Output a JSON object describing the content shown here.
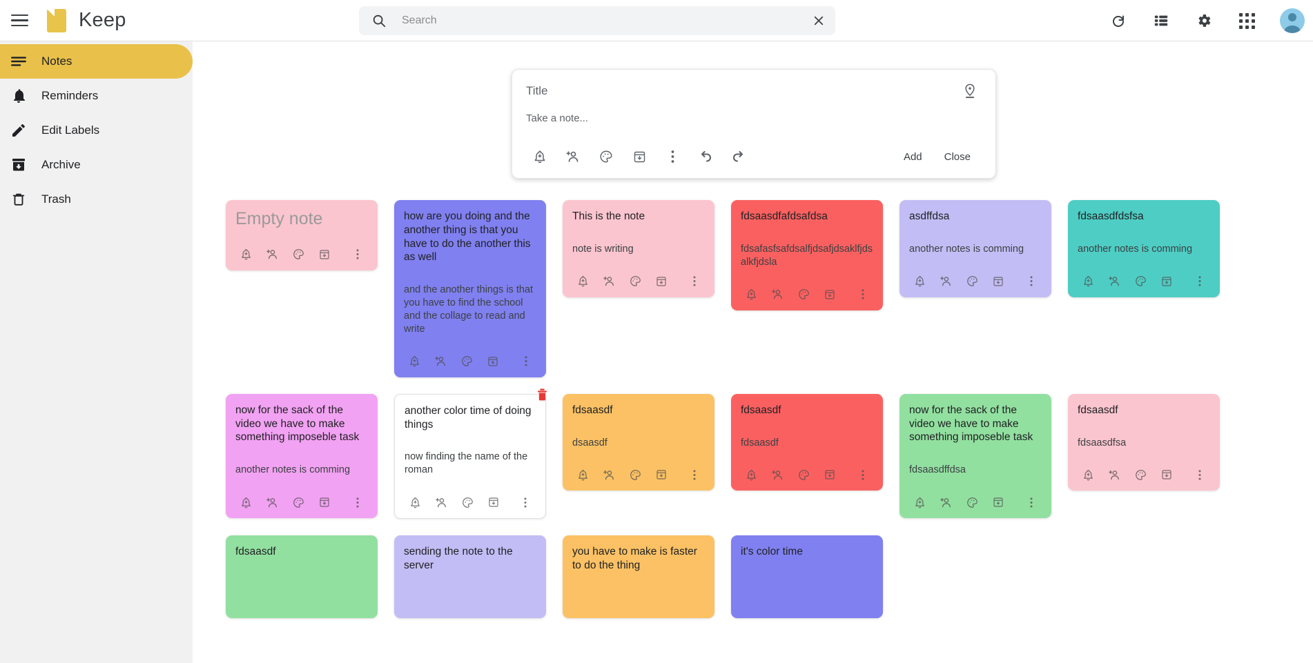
{
  "app": {
    "brand_title": "Keep",
    "logo_icon": "keep-note-logo"
  },
  "topbar": {
    "menu_icon": "hamburger-menu-icon",
    "search": {
      "icon": "search-icon",
      "value": "",
      "placeholder": "Search",
      "clear_icon": "close-icon"
    },
    "actions": [
      {
        "name": "refresh-button",
        "icon": "refresh-icon"
      },
      {
        "name": "list-view-button",
        "icon": "list-view-icon"
      },
      {
        "name": "settings-button",
        "icon": "gear-icon"
      },
      {
        "name": "apps-button",
        "icon": "apps-grid-icon"
      }
    ],
    "avatar": "user-avatar"
  },
  "sidebar": {
    "items": [
      {
        "label": "Notes",
        "icon": "notes-icon",
        "active": true
      },
      {
        "label": "Reminders",
        "icon": "bell-icon",
        "active": false
      },
      {
        "label": "Edit Labels",
        "icon": "pencil-icon",
        "active": false
      },
      {
        "label": "Archive",
        "icon": "archive-icon",
        "active": false
      },
      {
        "label": "Trash",
        "icon": "trash-icon",
        "active": false
      }
    ]
  },
  "composer": {
    "title_value": "",
    "title_placeholder": "Title",
    "body_value": "",
    "body_placeholder": "Take a note...",
    "pin_icon": "location-pin-icon",
    "actions": [
      {
        "name": "reminder-button",
        "icon": "bell-plus-icon"
      },
      {
        "name": "collaborator-button",
        "icon": "person-plus-icon"
      },
      {
        "name": "background-color-button",
        "icon": "palette-icon"
      },
      {
        "name": "archive-button",
        "icon": "archive-icon"
      },
      {
        "name": "more-options-button",
        "icon": "more-vert-icon"
      },
      {
        "name": "undo-button",
        "icon": "undo-icon"
      },
      {
        "name": "redo-button",
        "icon": "redo-icon"
      }
    ],
    "add_label": "Add",
    "close_label": "Close"
  },
  "note_actions": [
    {
      "name": "reminder-button",
      "icon": "bell-plus-icon"
    },
    {
      "name": "collaborator-button",
      "icon": "person-plus-icon"
    },
    {
      "name": "background-color-button",
      "icon": "palette-icon"
    },
    {
      "name": "archive-button",
      "icon": "archive-icon"
    },
    {
      "name": "more-options-button",
      "icon": "more-vert-icon"
    }
  ],
  "colors": {
    "brand_yellow": "#e8c44a",
    "sidebar_bg": "#f1f1f1",
    "search_bg": "#f1f3f4",
    "trash_red": "#e53935",
    "pink": "#fbc5cf",
    "periwinkle": "#8080f0",
    "light_pink": "#fbc5cf",
    "red": "#fb6060",
    "lavender": "#c3bdf5",
    "teal": "#4ecdc4",
    "magenta": "#f2a2f2",
    "white": "#ffffff",
    "orange": "#fbc164",
    "green": "#92e0a0"
  },
  "notes": [
    {
      "title": "Empty note",
      "body": "",
      "color": "#fbc5cf",
      "is_empty_placeholder": true,
      "show_trash": false
    },
    {
      "title": "how are you doing and the another thing is that you have to do the another this as well",
      "body": "and the another things is that you have to find the school and the collage to read and write",
      "color": "#8080f0",
      "is_empty_placeholder": false,
      "show_trash": false
    },
    {
      "title": "This is the note",
      "body": "note is writing",
      "color": "#fbc5cf",
      "is_empty_placeholder": false,
      "show_trash": false
    },
    {
      "title": "fdsaasdfafdsafdsa",
      "body": "fdsafasfsafdsalfjdsafjdsaklfjdsalkfjdsla",
      "color": "#fb6060",
      "is_empty_placeholder": false,
      "show_trash": false
    },
    {
      "title": "asdffdsa",
      "body": "another notes is comming",
      "color": "#c3bdf5",
      "is_empty_placeholder": false,
      "show_trash": false
    },
    {
      "title": "fdsaasdfdsfsa",
      "body": "another notes is comming",
      "color": "#4ecdc4",
      "is_empty_placeholder": false,
      "show_trash": false
    },
    {
      "title": "now for the sack of the video we have to make something imposeble task",
      "body": "another notes is comming",
      "color": "#f2a2f2",
      "is_empty_placeholder": false,
      "show_trash": false
    },
    {
      "title": "another color time of doing things",
      "body": "now finding the name of the roman",
      "color": "#ffffff",
      "is_empty_placeholder": false,
      "show_trash": true
    },
    {
      "title": "fdsaasdf",
      "body": "dsaasdf",
      "color": "#fbc164",
      "is_empty_placeholder": false,
      "show_trash": false
    },
    {
      "title": "fdsaasdf",
      "body": "fdsaasdf",
      "color": "#fb6060",
      "is_empty_placeholder": false,
      "show_trash": false
    },
    {
      "title": "now for the sack of the video we have to make something imposeble task",
      "body": "fdsaasdffdsa",
      "color": "#92e0a0",
      "is_empty_placeholder": false,
      "show_trash": false
    },
    {
      "title": "fdsaasdf",
      "body": "fdsaasdfsa",
      "color": "#fbc5cf",
      "is_empty_placeholder": false,
      "show_trash": false
    },
    {
      "title": "fdsaasdf",
      "body": "",
      "color": "#92e0a0",
      "is_empty_placeholder": false,
      "show_trash": false
    },
    {
      "title": "sending the note to the server",
      "body": "",
      "color": "#c3bdf5",
      "is_empty_placeholder": false,
      "show_trash": false
    },
    {
      "title": "you have to make is faster to do the thing",
      "body": "",
      "color": "#fbc164",
      "is_empty_placeholder": false,
      "show_trash": false
    },
    {
      "title": "it's color time",
      "body": "",
      "color": "#8080f0",
      "is_empty_placeholder": false,
      "show_trash": false
    }
  ]
}
